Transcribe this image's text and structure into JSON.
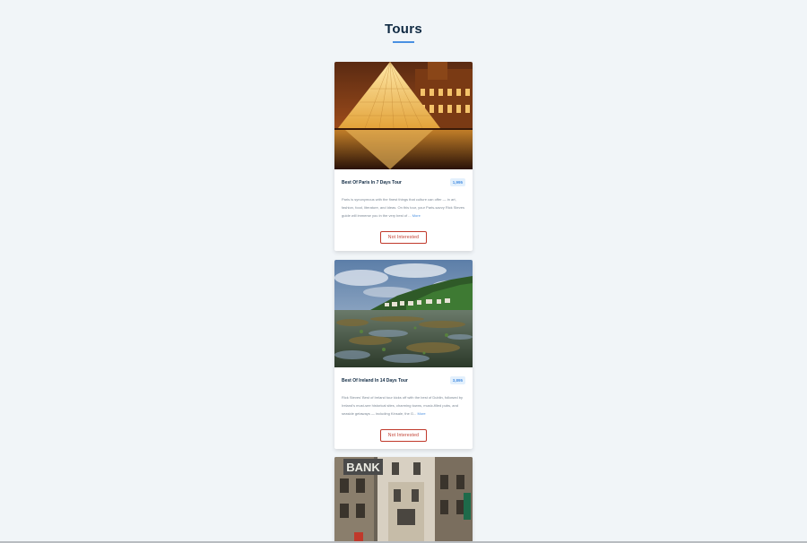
{
  "page": {
    "title": "Tours"
  },
  "tours": [
    {
      "name": "Best Of Paris In 7 Days Tour",
      "price": "1,995",
      "description": "Paris is synonymous with the finest things that culture can offer — in art, fashion, food, literature, and ideas. On this tour, your Paris-savvy Rick Steves guide will immerse you in the very best of ...",
      "more_label": "More",
      "button_label": "Not Interested",
      "image_icon": "louvre-pyramid-image"
    },
    {
      "name": "Best Of Ireland In 14 Days Tour",
      "price": "3,895",
      "description": "Rick Steves' Best of Ireland tour kicks off with the best of Dublin, followed by Ireland's must-see historical sites, charming towns, music-filled pubs, and seaside getaways — including Kinsale, the G...",
      "more_label": "More",
      "button_label": "Not Interested",
      "image_icon": "ireland-coast-image"
    },
    {
      "image_sign": "BANK",
      "image_icon": "city-street-bank-image"
    }
  ],
  "colors": {
    "accent": "#4a90e2",
    "button": "#c0392b",
    "background": "#f1f5f8"
  }
}
